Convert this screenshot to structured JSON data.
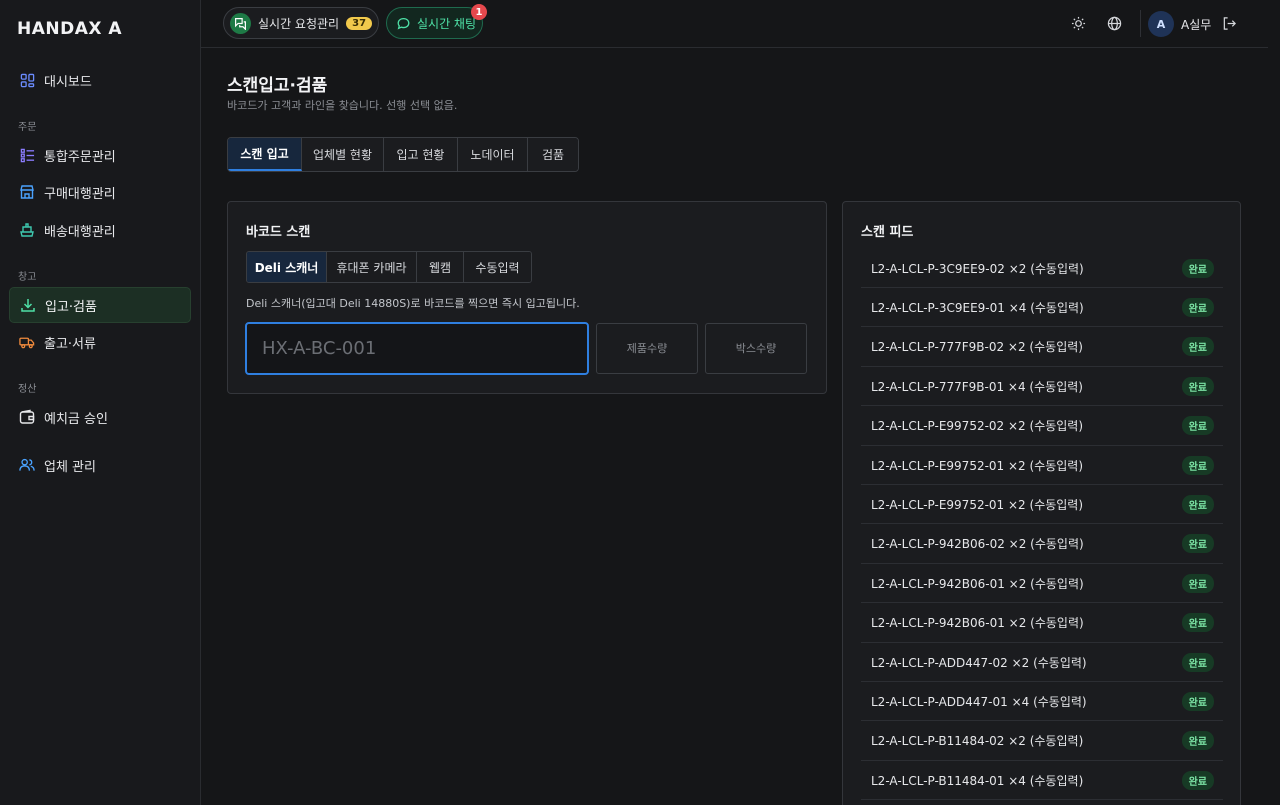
{
  "brand": "HANDAX A",
  "sidebar": {
    "dashboard": "대시보드",
    "sections": {
      "order": "주문",
      "warehouse": "창고",
      "settlement": "정산"
    },
    "items": {
      "integrated_order": "통합주문관리",
      "purchase_agent": "구매대행관리",
      "shipping_agent": "배송대행관리",
      "inbound_inspection": "입고·검품",
      "outbound_docs": "출고·서류",
      "deposit_approval": "예치금 승인",
      "vendor_mgmt": "업체 관리"
    }
  },
  "topbar": {
    "request_label": "실시간 요청관리",
    "request_count": "37",
    "chat_label": "실시간 채팅",
    "chat_badge": "1",
    "avatar_initial": "A",
    "username": "A실무"
  },
  "page": {
    "title": "스캔입고·검품",
    "subtitle": "바코드가 고객과 라인을 찾습니다. 선행 선택 없음."
  },
  "tabs": [
    "스캔 입고",
    "업체별 현황",
    "입고 현황",
    "노데이터",
    "검품"
  ],
  "scan_card": {
    "title": "바코드 스캔",
    "subtabs": [
      "Deli 스캐너",
      "휴대폰 카메라",
      "웹캠",
      "수동입력"
    ],
    "hint": "Deli 스캐너(입고대 Deli 14880S)로 바코드를 찍으면 즉시 입고됩니다.",
    "barcode_placeholder": "HX-A-BC-001",
    "product_qty_placeholder": "제품수량",
    "box_qty_placeholder": "박스수량"
  },
  "feed": {
    "title": "스캔 피드",
    "items": [
      {
        "text": "L2-A-LCL-P-3C9EE9-02 ×2 (수동입력)",
        "status": "완료"
      },
      {
        "text": "L2-A-LCL-P-3C9EE9-01 ×4 (수동입력)",
        "status": "완료"
      },
      {
        "text": "L2-A-LCL-P-777F9B-02 ×2 (수동입력)",
        "status": "완료"
      },
      {
        "text": "L2-A-LCL-P-777F9B-01 ×4 (수동입력)",
        "status": "완료"
      },
      {
        "text": "L2-A-LCL-P-E99752-02 ×2 (수동입력)",
        "status": "완료"
      },
      {
        "text": "L2-A-LCL-P-E99752-01 ×2 (수동입력)",
        "status": "완료"
      },
      {
        "text": "L2-A-LCL-P-E99752-01 ×2 (수동입력)",
        "status": "완료"
      },
      {
        "text": "L2-A-LCL-P-942B06-02 ×2 (수동입력)",
        "status": "완료"
      },
      {
        "text": "L2-A-LCL-P-942B06-01 ×2 (수동입력)",
        "status": "완료"
      },
      {
        "text": "L2-A-LCL-P-942B06-01 ×2 (수동입력)",
        "status": "완료"
      },
      {
        "text": "L2-A-LCL-P-ADD447-02 ×2 (수동입력)",
        "status": "완료"
      },
      {
        "text": "L2-A-LCL-P-ADD447-01 ×4 (수동입력)",
        "status": "완료"
      },
      {
        "text": "L2-A-LCL-P-B11484-02 ×2 (수동입력)",
        "status": "완료"
      },
      {
        "text": "L2-A-LCL-P-B11484-01 ×4 (수동입력)",
        "status": "완료"
      }
    ]
  },
  "colors": {
    "accent_blue": "#2f7fe0",
    "accent_green": "#4ee0a6",
    "status_green": "#7be3a4",
    "badge_red": "#e5484d",
    "count_yellow": "#f2c94c"
  }
}
